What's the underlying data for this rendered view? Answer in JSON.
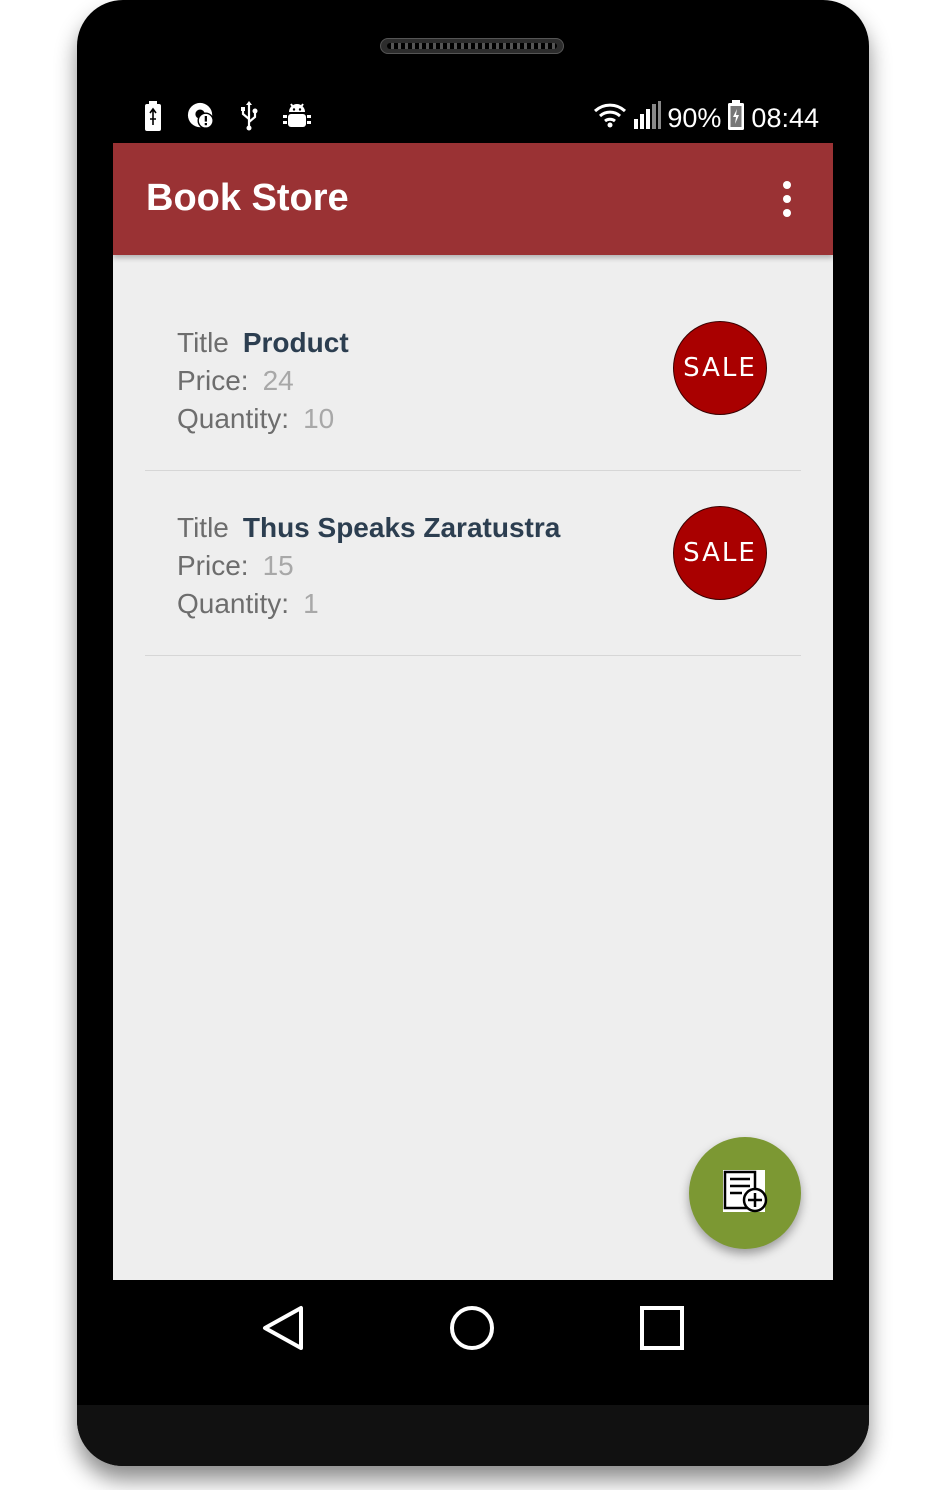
{
  "status_bar": {
    "left_icons": [
      "battery-charging-icon",
      "data-saver-alert-icon",
      "usb-icon",
      "android-debug-icon"
    ],
    "wifi_icon": "wifi-icon",
    "signal_icon": "cell-signal-icon",
    "battery_percent": "90%",
    "battery_icon": "battery-icon",
    "time": "08:44"
  },
  "app_bar": {
    "title": "Book Store",
    "menu_icon": "overflow-menu-icon",
    "color": "#9a3234"
  },
  "books": [
    {
      "title_label": "Title",
      "title": "Product",
      "price_label": "Price:",
      "price": "24",
      "quantity_label": "Quantity:",
      "quantity": "10",
      "sale_label": "SALE"
    },
    {
      "title_label": "Title",
      "title": "Thus Speaks Zaratustra",
      "price_label": "Price:",
      "price": "15",
      "quantity_label": "Quantity:",
      "quantity": "1",
      "sale_label": "SALE"
    }
  ],
  "fab": {
    "icon": "add-book-icon",
    "color": "#7c9833"
  },
  "nav_bar": {
    "back_icon": "back-triangle-icon",
    "home_icon": "home-circle-icon",
    "recents_icon": "recents-square-icon"
  },
  "colors": {
    "sale": "#a90000",
    "background": "#eeeeee"
  }
}
